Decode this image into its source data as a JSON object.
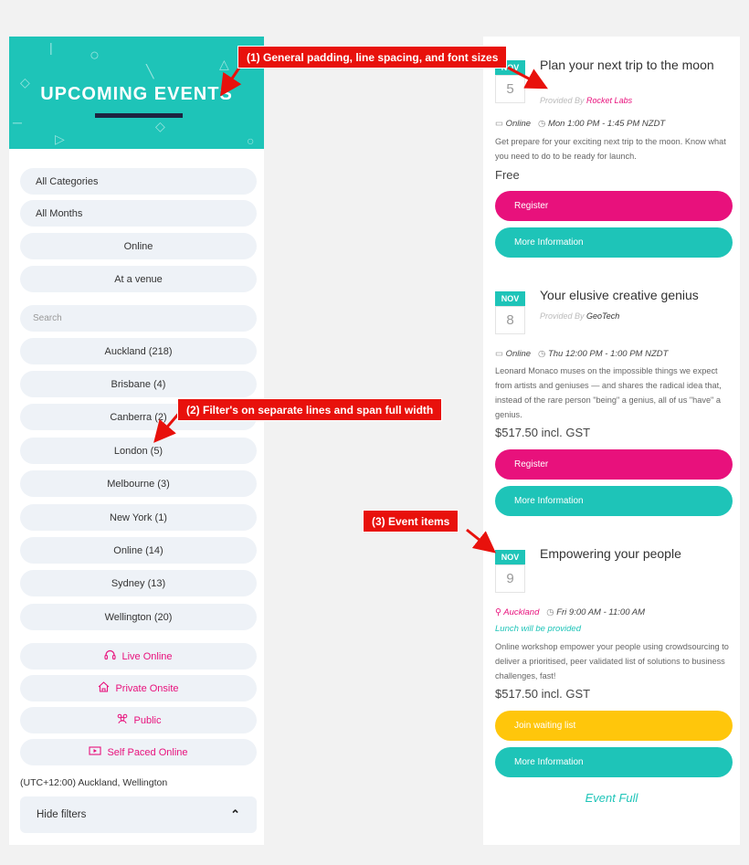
{
  "banner": {
    "title": "UPCOMING EVENTS"
  },
  "filters": {
    "category": "All Categories",
    "months": "All Months",
    "online": "Online",
    "venue": "At a venue",
    "search_placeholder": "Search",
    "locations": [
      "Auckland (218)",
      "Brisbane (4)",
      "Canberra (2)",
      "London (5)",
      "Melbourne (3)",
      "New York (1)",
      "Online (14)",
      "Sydney (13)",
      "Wellington (20)"
    ],
    "types": [
      {
        "label": "Live Online",
        "icon": "headset-icon"
      },
      {
        "label": "Private Onsite",
        "icon": "house-icon"
      },
      {
        "label": "Public",
        "icon": "people-icon"
      },
      {
        "label": "Self Paced Online",
        "icon": "video-icon"
      }
    ],
    "timezone": "(UTC+12:00) Auckland, Wellington",
    "hide_label": "Hide filters"
  },
  "events": [
    {
      "month": "NOV",
      "day": "5",
      "title": "Plan your next trip to the moon",
      "provided_by": "Provided By",
      "provider": "Rocket Labs",
      "location": "Online",
      "time": "Mon 1:00 PM - 1:45 PM NZDT",
      "description": "Get prepare for your exciting next trip to the moon. Know what you need to do to be ready for launch.",
      "price": "Free",
      "primary_button": "Register",
      "secondary_button": "More Information"
    },
    {
      "month": "NOV",
      "day": "8",
      "title": "Your elusive creative genius",
      "provided_by": "Provided By",
      "provider": "GeoTech",
      "location": "Online",
      "time": "Thu 12:00 PM - 1:00 PM NZDT",
      "description": "Leonard Monaco muses on the impossible things we expect from artists and geniuses — and shares the radical idea that, instead of the rare person \"being\" a genius, all of us \"have\" a genius.",
      "price": "$517.50 incl. GST",
      "primary_button": "Register",
      "secondary_button": "More Information"
    },
    {
      "month": "NOV",
      "day": "9",
      "title": "Empowering your people",
      "location": "Auckland",
      "time": "Fri 9:00 AM - 11:00 AM",
      "note": "Lunch will be provided",
      "description": "Online workshop empower your people using crowdsourcing to deliver a prioritised, peer validated list of solutions to business challenges, fast!",
      "price": "$517.50 incl. GST",
      "primary_button": "Join waiting list",
      "secondary_button": "More Information",
      "status": "Event Full"
    }
  ],
  "annotations": {
    "a1": "(1) General padding, line spacing, and font sizes",
    "a2": "(2) Filter's on separate lines and span full width",
    "a3": "(3) Event items"
  },
  "colors": {
    "teal": "#1ec4b8",
    "pink": "#e8117c",
    "yellow": "#ffc60b",
    "annotation": "#e8110c"
  }
}
